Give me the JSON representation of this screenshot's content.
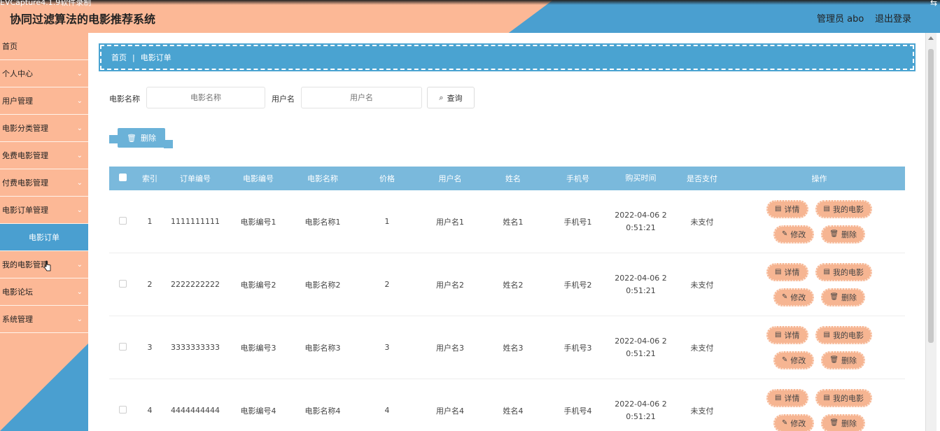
{
  "watermark": "EVCapture4.1.9软件录制",
  "app_title": "协同过滤算法的电影推荐系统",
  "header": {
    "user_text": "管理员 abo",
    "logout": "退出登录"
  },
  "sidebar": {
    "items": [
      {
        "label": "首页",
        "chevron": false
      },
      {
        "label": "个人中心",
        "chevron": true
      },
      {
        "label": "用户管理",
        "chevron": true
      },
      {
        "label": "电影分类管理",
        "chevron": true
      },
      {
        "label": "免费电影管理",
        "chevron": true
      },
      {
        "label": "付费电影管理",
        "chevron": true
      },
      {
        "label": "电影订单管理",
        "chevron": true
      },
      {
        "label": "电影订单",
        "chevron": false,
        "active": true
      },
      {
        "label": "我的电影管理",
        "chevron": true
      },
      {
        "label": "电影论坛",
        "chevron": true
      },
      {
        "label": "系统管理",
        "chevron": true
      }
    ]
  },
  "breadcrumb": {
    "home": "首页",
    "separator": "|",
    "current": "电影订单"
  },
  "search": {
    "movie_name_label": "电影名称",
    "movie_name_placeholder": "电影名称",
    "username_label": "用户名",
    "username_placeholder": "用户名",
    "query_label": "查询",
    "query_icon": "search-icon"
  },
  "toolbar": {
    "delete_label": "删除",
    "delete_icon": "trash-icon"
  },
  "table": {
    "columns": [
      "索引",
      "订单编号",
      "电影编号",
      "电影名称",
      "价格",
      "用户名",
      "姓名",
      "手机号",
      "购买时间",
      "是否支付",
      "操作"
    ],
    "rows": [
      {
        "index": "1",
        "order_no": "1111111111",
        "movie_no": "电影编号1",
        "movie_name": "电影名称1",
        "price": "1",
        "username": "用户名1",
        "name": "姓名1",
        "phone": "手机号1",
        "time_a": "2022-04-06 2",
        "time_b": "0:51:21",
        "paid": "未支付"
      },
      {
        "index": "2",
        "order_no": "2222222222",
        "movie_no": "电影编号2",
        "movie_name": "电影名称2",
        "price": "2",
        "username": "用户名2",
        "name": "姓名2",
        "phone": "手机号2",
        "time_a": "2022-04-06 2",
        "time_b": "0:51:21",
        "paid": "未支付"
      },
      {
        "index": "3",
        "order_no": "3333333333",
        "movie_no": "电影编号3",
        "movie_name": "电影名称3",
        "price": "3",
        "username": "用户名3",
        "name": "姓名3",
        "phone": "手机号3",
        "time_a": "2022-04-06 2",
        "time_b": "0:51:21",
        "paid": "未支付"
      },
      {
        "index": "4",
        "order_no": "4444444444",
        "movie_no": "电影编号4",
        "movie_name": "电影名称4",
        "price": "4",
        "username": "用户名4",
        "name": "姓名4",
        "phone": "手机号4",
        "time_a": "2022-04-06 2",
        "time_b": "0:51:21",
        "paid": "未支付"
      }
    ],
    "actions": {
      "detail": "详情",
      "my_movie": "我的电影",
      "edit": "修改",
      "delete": "删除"
    }
  },
  "colors": {
    "accent_blue": "#4a9fd0",
    "accent_peach": "#fcb896"
  }
}
